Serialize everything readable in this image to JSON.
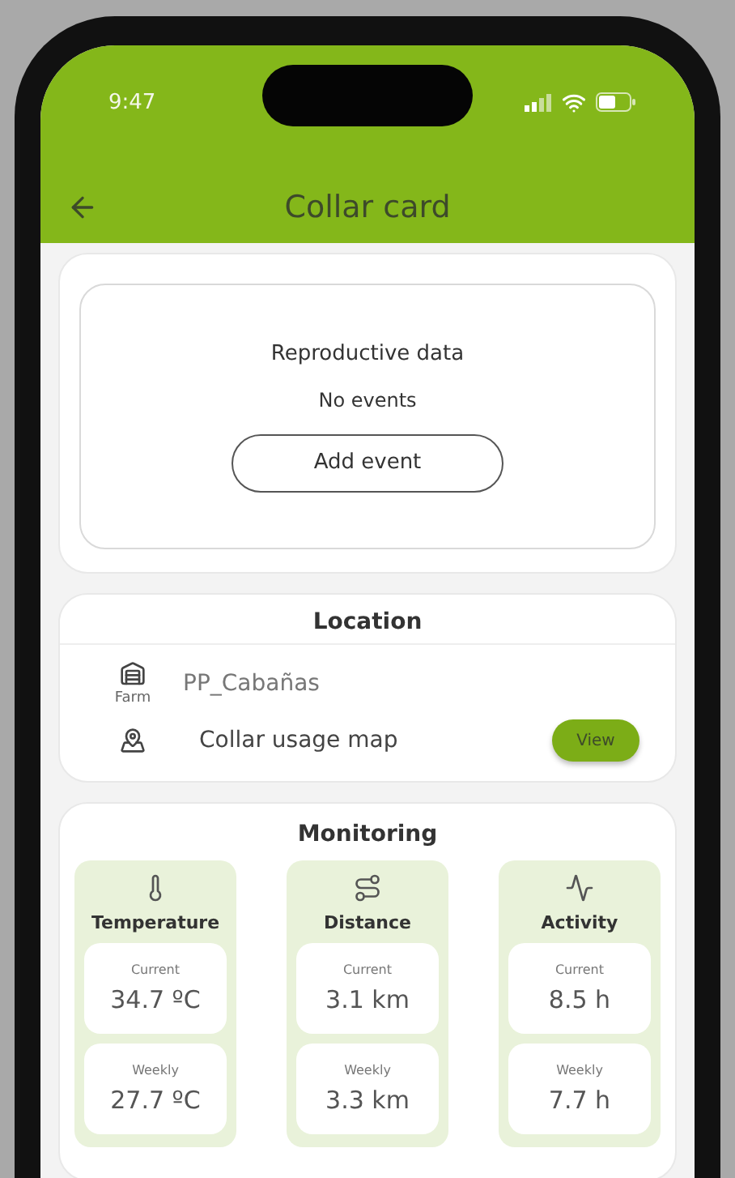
{
  "status_bar": {
    "time": "9:47"
  },
  "header": {
    "title": "Collar card"
  },
  "reproductive": {
    "title": "Reproductive data",
    "empty_text": "No events",
    "button": "Add event"
  },
  "location": {
    "title": "Location",
    "farm_name": "PP_Cabañas",
    "farm_label": "Farm",
    "map_label": "Collar usage map",
    "map_button": "View"
  },
  "monitoring": {
    "title": "Monitoring",
    "metrics": [
      {
        "kind": "temperature",
        "label": "Temperature",
        "current_label": "Current",
        "current": "34.7 ºC",
        "weekly_label": "Weekly",
        "weekly": "27.7 ºC"
      },
      {
        "kind": "distance",
        "label": "Distance",
        "current_label": "Current",
        "current": "3.1 km",
        "weekly_label": "Weekly",
        "weekly": "3.3 km"
      },
      {
        "kind": "activity",
        "label": "Activity",
        "current_label": "Current",
        "current": "8.5 h",
        "weekly_label": "Weekly",
        "weekly": "7.7 h"
      }
    ]
  }
}
